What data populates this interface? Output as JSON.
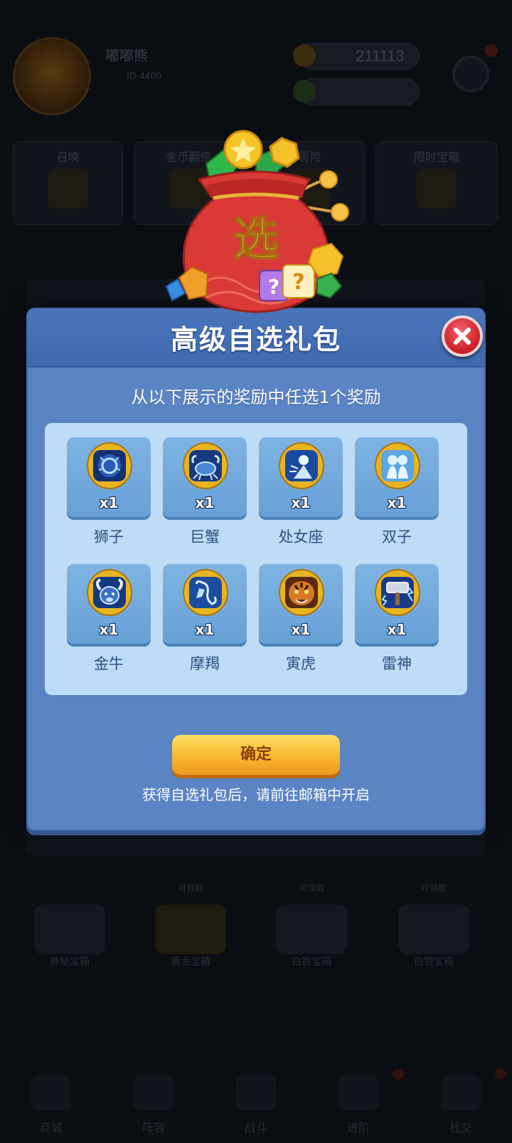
{
  "background": {
    "player_name": "嘟嘟熊",
    "player_sub": "ID 4400",
    "money": "211113",
    "cards": [
      "召唤",
      "金币翻倍",
      "冒险",
      "限时宝箱"
    ],
    "chests": [
      {
        "tag": "",
        "label": "神秘宝箱"
      },
      {
        "tag": "可领取",
        "label": "黄金宝箱"
      },
      {
        "tag": "可领取",
        "label": "白银宝箱"
      },
      {
        "tag": "可领取",
        "label": "白银宝箱"
      }
    ],
    "tabs": [
      "商城",
      "阵容",
      "战斗",
      "进阶",
      "社交"
    ]
  },
  "modal": {
    "title": "高级自选礼包",
    "subtitle": "从以下展示的奖励中任选1个奖励",
    "items": [
      {
        "name": "狮子",
        "qty": "x1",
        "icon": "leo-zodiac-icon"
      },
      {
        "name": "巨蟹",
        "qty": "x1",
        "icon": "cancer-zodiac-icon"
      },
      {
        "name": "处女座",
        "qty": "x1",
        "icon": "virgo-zodiac-icon"
      },
      {
        "name": "双子",
        "qty": "x1",
        "icon": "gemini-zodiac-icon"
      },
      {
        "name": "金牛",
        "qty": "x1",
        "icon": "taurus-zodiac-icon"
      },
      {
        "name": "摩羯",
        "qty": "x1",
        "icon": "capricorn-zodiac-icon"
      },
      {
        "name": "寅虎",
        "qty": "x1",
        "icon": "tiger-icon"
      },
      {
        "name": "雷神",
        "qty": "x1",
        "icon": "thunder-hammer-icon"
      }
    ],
    "confirm_label": "确定",
    "hint": "获得自选礼包后，请前往邮箱中开启",
    "bag_char": "选"
  },
  "colors": {
    "modal_bg": "#5b84c4",
    "header_bg": "#4272b5",
    "grid_bg": "#bedcf5",
    "tile_bg": "#74aadd",
    "confirm_btn": "#f8b830",
    "close_btn": "#d1262e"
  }
}
